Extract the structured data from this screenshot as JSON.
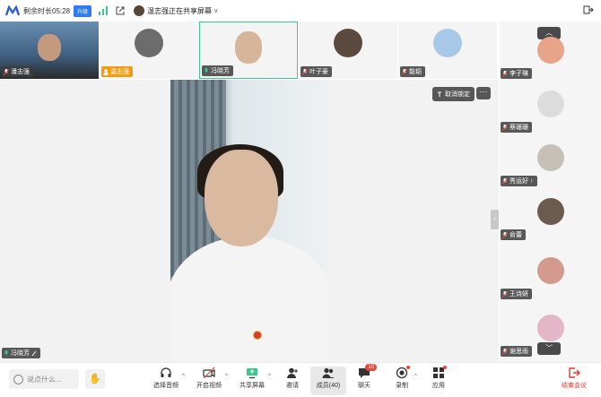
{
  "topbar": {
    "remaining_time": "剩余时长05:28",
    "upgrade_label": "升级",
    "share_status": "温志强正在共享屏幕",
    "dropdown_chevron": "v"
  },
  "strip": [
    {
      "name": "潘志强",
      "avatar_color": "#3a5f82"
    },
    {
      "name": "温志强",
      "avatar_color": "#6c6c6c"
    },
    {
      "name": "冯晓芳",
      "avatar_color": "#d6b59a"
    },
    {
      "name": "叶子豪",
      "avatar_color": "#5d4a3f"
    },
    {
      "name": "能韬",
      "avatar_color": "#a8c8e8"
    }
  ],
  "main": {
    "speaker_name": "冯晓芳",
    "unlock_label": "取消锁定",
    "more_label": "···",
    "handle_label": "›"
  },
  "sidebar": {
    "up_arrow": "︿",
    "down_arrow": "﹀",
    "participants": [
      {
        "name": "李子琳",
        "avatar_color": "#e8a488"
      },
      {
        "name": "蔡珊珊",
        "avatar_color": "#dcdcdc"
      },
      {
        "name": "秀运好",
        "avatar_color": "#c7c0b7"
      },
      {
        "name": "俞蕾",
        "avatar_color": "#6b5a4e"
      },
      {
        "name": "王诗妍",
        "avatar_color": "#d49a8e"
      },
      {
        "name": "谢思雨",
        "avatar_color": "#e3b7c8"
      }
    ]
  },
  "toolbar": {
    "say_placeholder": "说点什么...",
    "hand_icon": "✋",
    "tools": [
      {
        "label": "选择音频"
      },
      {
        "label": "开启视频"
      },
      {
        "label": "共享屏幕"
      },
      {
        "label": "邀请"
      },
      {
        "label": "成员(40)"
      },
      {
        "label": "聊天",
        "badge": "10"
      },
      {
        "label": "录制"
      },
      {
        "label": "应用"
      }
    ],
    "end_label": "结束会议"
  },
  "colors": {
    "accent": "#2f7af7",
    "active_border": "#3bc88b",
    "end_red": "#e5382c"
  }
}
